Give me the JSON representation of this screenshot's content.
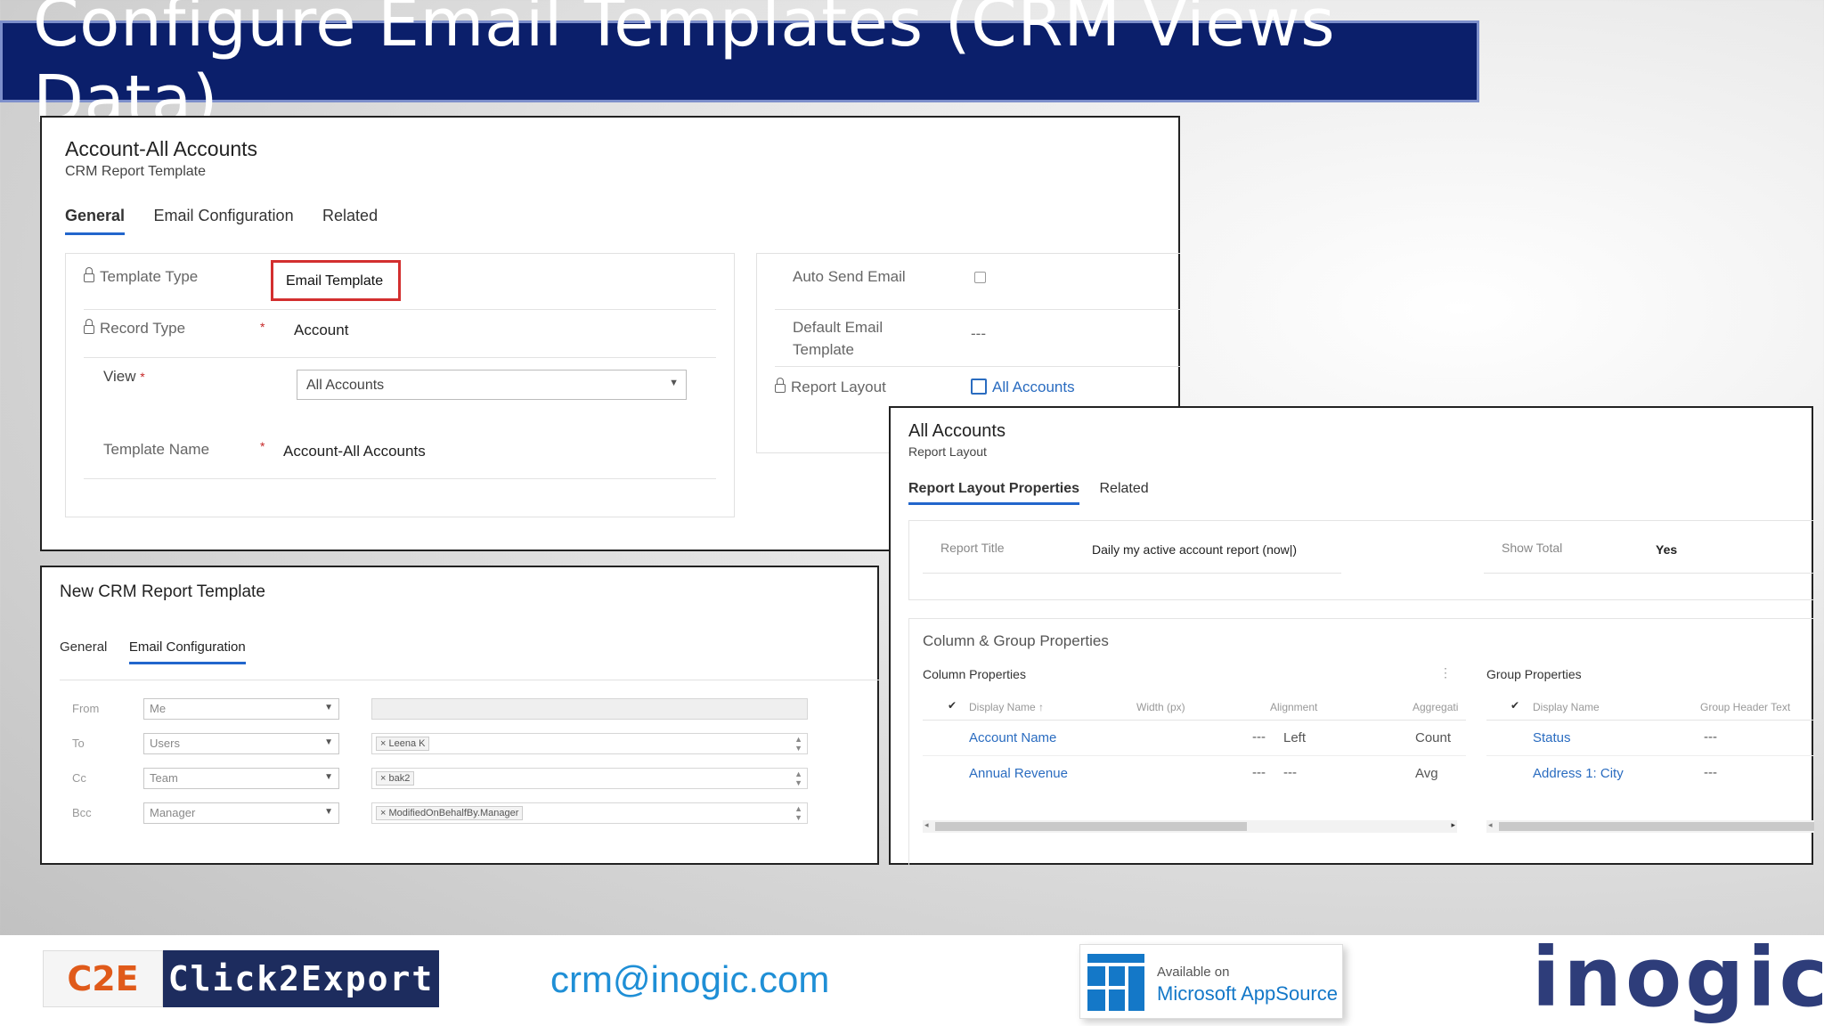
{
  "title": "Configure Email Templates (CRM Views Data)",
  "account_panel": {
    "heading": "Account-All Accounts",
    "subheading": "CRM Report Template",
    "tabs": [
      "General",
      "Email Configuration",
      "Related"
    ],
    "template_type_label": "Template Type",
    "template_type_value": "Email Template",
    "record_type_label": "Record Type",
    "record_type_value": "Account",
    "view_label": "View",
    "view_required": "*",
    "view_value": "All Accounts",
    "template_name_label": "Template Name",
    "template_name_value": "Account-All Accounts",
    "required_mark": "*",
    "auto_send_label": "Auto Send Email",
    "default_email_label_1": "Default Email",
    "default_email_label_2": "Template",
    "default_email_value": "---",
    "report_layout_label": "Report Layout",
    "report_layout_value": "All Accounts"
  },
  "new_panel": {
    "heading": "New CRM Report Template",
    "tabs": [
      "General",
      "Email Configuration"
    ],
    "rows": [
      {
        "label": "From",
        "select": "Me",
        "chip": ""
      },
      {
        "label": "To",
        "select": "Users",
        "chip": "× Leena K"
      },
      {
        "label": "Cc",
        "select": "Team",
        "chip": "× bak2"
      },
      {
        "label": "Bcc",
        "select": "Manager",
        "chip": "× ModifiedOnBehalfBy.Manager"
      }
    ]
  },
  "layout_panel": {
    "heading": "All Accounts",
    "subheading": "Report Layout",
    "tabs": [
      "Report Layout Properties",
      "Related"
    ],
    "report_title_label": "Report Title",
    "report_title_value": "Daily my active account report (now|)",
    "show_total_label": "Show Total",
    "show_total_value": "Yes",
    "section_title": "Column & Group Properties",
    "column_props_title": "Column Properties",
    "group_props_title": "Group Properties",
    "col_headers": [
      "Display Name ↑",
      "Width (px)",
      "Alignment",
      "Aggregati"
    ],
    "group_headers": [
      "Display Name",
      "Group Header Text"
    ],
    "col_rows": [
      {
        "name": "Account Name",
        "width": "---",
        "align": "Left",
        "agg": "Count"
      },
      {
        "name": "Annual Revenue",
        "width": "---",
        "align": "---",
        "agg": "Avg"
      }
    ],
    "group_rows": [
      {
        "name": "Status",
        "header": "---"
      },
      {
        "name": "Address 1: City",
        "header": "---"
      }
    ]
  },
  "footer": {
    "brand1_short": "C2E",
    "brand1_name": "Click2Export",
    "email": "crm@inogic.com",
    "appsource_line1": "Available on",
    "appsource_line2": "Microsoft AppSource",
    "brand2": "inogic"
  }
}
